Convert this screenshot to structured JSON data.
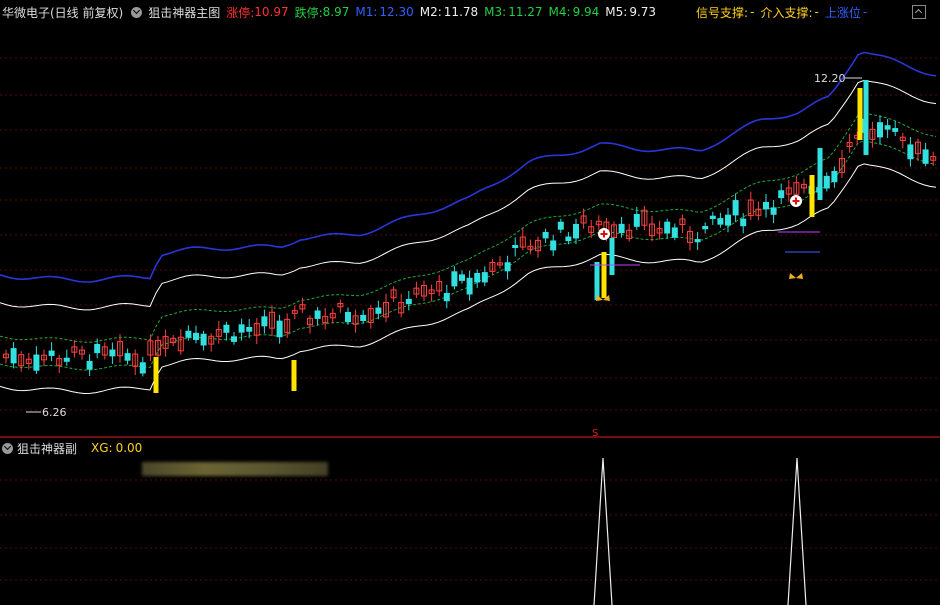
{
  "header": {
    "stock_name": "华微电子(日线 前复权)",
    "indicator_name": "狙击神器主图",
    "limit_up": {
      "label": "涨停:",
      "value": "10.97"
    },
    "limit_down": {
      "label": "跌停:",
      "value": "8.97"
    },
    "m1": {
      "label": "M1:",
      "value": "12.30"
    },
    "m2": {
      "label": "M2:",
      "value": "11.78"
    },
    "m3": {
      "label": "M3:",
      "value": "11.27"
    },
    "m4": {
      "label": "M4:",
      "value": "9.94"
    },
    "m5": {
      "label": "M5:",
      "value": "9.73"
    },
    "signal_support": {
      "label": "信号支撑:",
      "value": "-"
    },
    "entry_support": {
      "label": "介入支撑:",
      "value": "-"
    },
    "up_target": {
      "label": "上涨位",
      "value": "-"
    }
  },
  "annotations": {
    "high_price": "12.20",
    "low_price": "6.26",
    "divider_marker": "S"
  },
  "sub_panel": {
    "indicator_name": "狙击神器副",
    "xg_label": "XG:",
    "xg_value": "0.00"
  },
  "colors": {
    "up": "#ff4040",
    "down": "#33e0e0",
    "signal_bar": "#ffe400",
    "band_outer": "#2a35d8",
    "band_mid": "#ffffff",
    "band_inner": "#1fa83a",
    "grid": "#5a0a0a"
  }
}
